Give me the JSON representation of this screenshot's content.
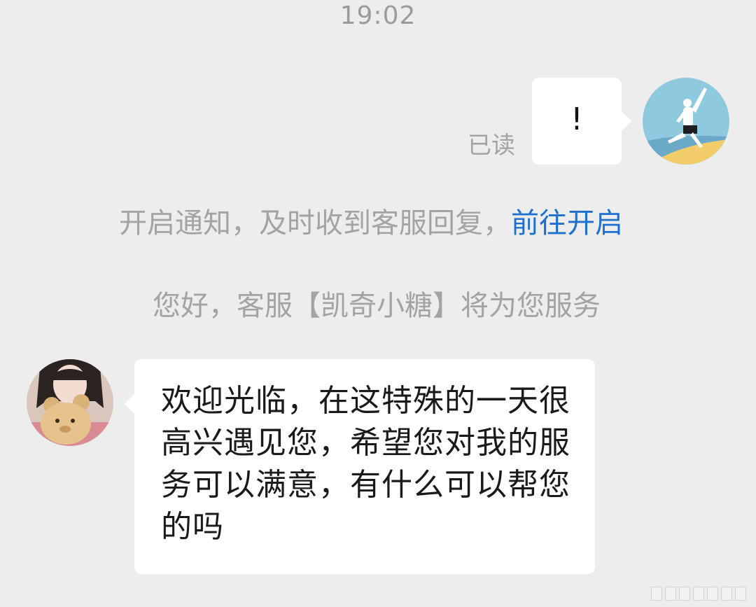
{
  "chat": {
    "timestamp": "19:02",
    "read_status": "已读",
    "sent_message": "!",
    "notice_text": "开启通知，及时收到客服回复，",
    "notice_link": "前往开启",
    "system_welcome": "您好，客服【凯奇小糖】将为您服务",
    "agent_message": "欢迎光临，在这特殊的一天很高兴遇见您，希望您对我的服务可以满意，有什么可以帮您的吗"
  },
  "colors": {
    "background": "#ededed",
    "bubble": "#ffffff",
    "link": "#1f6fcf",
    "system_text": "#a3a3a3"
  },
  "icons": {
    "user_avatar": "user-avatar-beach-jump",
    "agent_avatar": "agent-avatar-girl-with-bear"
  }
}
